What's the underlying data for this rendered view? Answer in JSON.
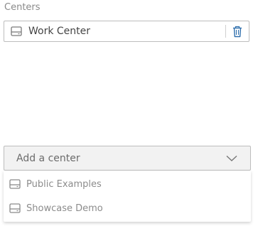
{
  "section": {
    "title": "Centers"
  },
  "centers": [
    {
      "label": "Work Center",
      "icon": "drive-icon",
      "action_icon": "trash-icon"
    }
  ],
  "add_center": {
    "placeholder": "Add a center",
    "icon": "chevron-down-icon",
    "options": [
      {
        "label": "Public Examples",
        "icon": "drive-icon"
      },
      {
        "label": "Showcase Demo",
        "icon": "drive-icon"
      }
    ]
  },
  "colors": {
    "border": "#bdbdbd",
    "text": "#444444",
    "muted_text": "#8c8c8c",
    "select_bg": "#f2f2f2",
    "trash": "#2f6fad"
  }
}
